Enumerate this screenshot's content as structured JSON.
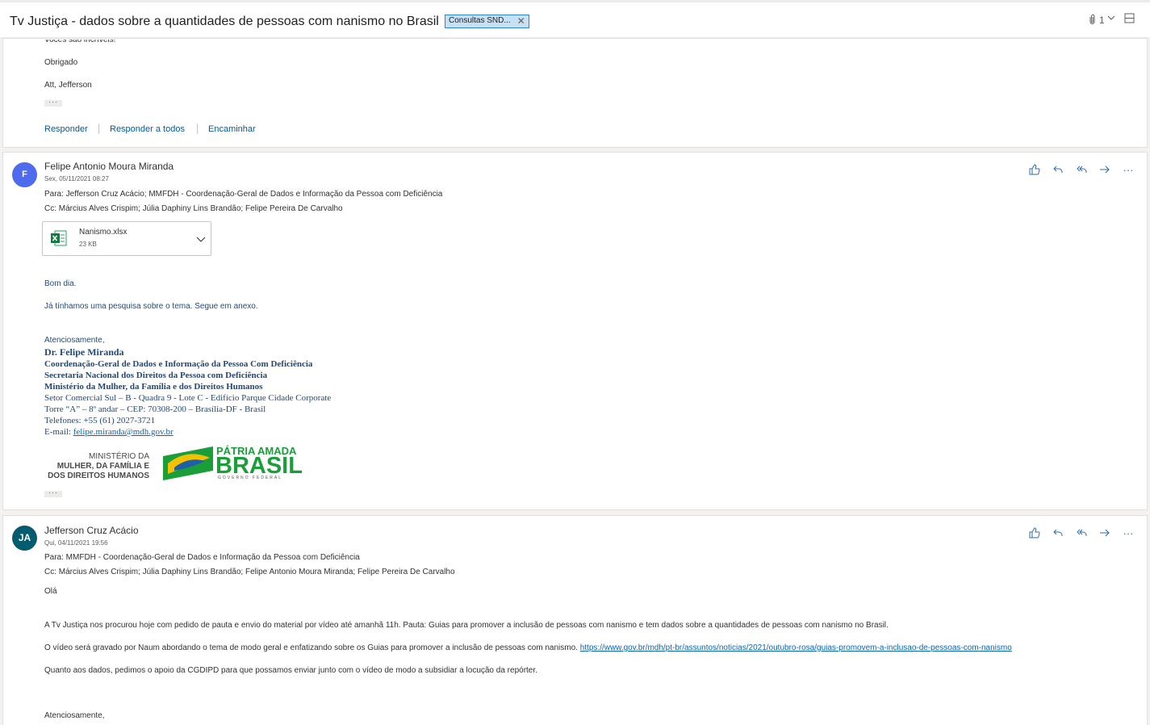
{
  "header": {
    "subject": "Tv Justiça - dados sobre a quantidades de pessoas com nanismo no Brasil",
    "category": "Consultas SND...",
    "attachment_count": "1",
    "icons": [
      "paperclip-icon",
      "chevron-down-icon",
      "window-icon"
    ]
  },
  "message_prev": {
    "lines": [
      "Vocês são incríveis!",
      "Obrigado",
      "Att, Jefferson"
    ],
    "actions": {
      "reply": "Responder",
      "reply_all": "Responder a todos",
      "forward": "Encaminhar"
    }
  },
  "message1": {
    "avatar_initials": "F",
    "avatar_color": "#4f6bed",
    "sender": "Felipe Antonio Moura Miranda",
    "date": "Sex, 05/11/2021 08:27",
    "to": "Para:  Jefferson Cruz Acácio; MMFDH - Coordenação-Geral de Dados e Informação da Pessoa com Deficiência",
    "cc": "Cc:  Március Alves Crispim; Júlia Daphiny Lins Brandão; Felipe Pereira De Carvalho",
    "attachment": {
      "name": "Nanismo.xlsx",
      "size": "23 KB"
    },
    "body": [
      "Bom dia.",
      "Já tínhamos uma pesquisa sobre o tema. Segue em anexo."
    ],
    "signature": {
      "greeting": "Atenciosamente,",
      "name": "Dr. Felipe Miranda",
      "line1": "Coordenação-Geral de Dados e Informação da Pessoa Com Deficiência",
      "line2": "Secretaria Nacional dos Direitos da Pessoa com Deficiência",
      "line3": "Ministério da Mulher, da Família e dos Direitos Humanos",
      "addr1": "Setor Comercial Sul – B - Quadra 9 - Lote C - Edifício Parque Cidade Corporate",
      "addr2": "Torre “A” – 8º andar – CEP: 70308-200 – Brasília-DF - Brasil",
      "phone": "Telefones: +55 (61) 2027-3721",
      "email_label": "E-mail: ",
      "email": "felipe.miranda@mdh.gov.br",
      "logo_ministry": [
        "MINISTÉRIO DA",
        "MULHER, DA FAMÍLIA E",
        "DOS DIREITOS HUMANOS"
      ],
      "logo_brasil": [
        "PÁTRIA AMADA",
        "BRASIL",
        "GOVERNO FEDERAL"
      ]
    }
  },
  "message2": {
    "avatar_initials": "JA",
    "avatar_color": "#025c6e",
    "sender": "Jefferson Cruz Acácio",
    "date": "Qui, 04/11/2021 19:56",
    "to": "Para:  MMFDH - Coordenação-Geral de Dados e Informação da Pessoa com Deficiência",
    "cc": "Cc:  Március Alves Crispim; Júlia Daphiny Lins Brandão; Felipe Antonio Moura Miranda; Felipe Pereira De Carvalho",
    "body": {
      "p1": "Olá",
      "p2": "A Tv Justiça nos procurou hoje com pedido de pauta e envio do material por vídeo até amanhã 11h. Pauta:  Guias para promover a inclusão de pessoas com nanismo e tem dados sobre a quantidades de pessoas com nanismo no Brasil.",
      "p3": "O vídeo será gravado por Naum abordando o tema de modo geral e enfatizando sobre os Guias para promover a inclusão de pessoas com nanismo. ",
      "p3_link": "https://www.gov.br/mdh/pt-br/assuntos/noticias/2021/outubro-rosa/guias-promovem-a-inclusao-de-pessoas-com-nanismo",
      "p4": "Quanto aos dados, pedimos o apoio da CGDIPD para que possamos enviar junto com o vídeo de modo a subsidiar a locução da repórter.",
      "p5": "Atenciosamente,"
    }
  },
  "toolbar_icons": [
    "like-icon",
    "reply-icon",
    "reply-all-icon",
    "forward-icon",
    "more-icon"
  ]
}
